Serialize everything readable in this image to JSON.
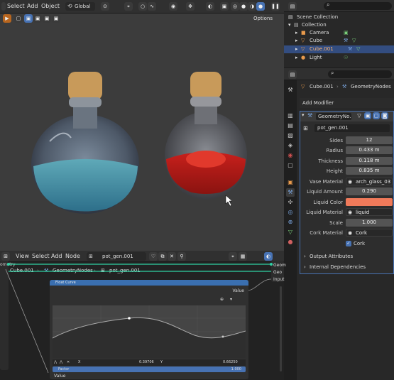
{
  "top_menu": {
    "select": "Select",
    "add": "Add",
    "object": "Object",
    "transform": "Global",
    "options": "Options"
  },
  "outliner": {
    "search_placeholder": "",
    "scene_collection": "Scene Collection",
    "collection": "Collection",
    "items": [
      {
        "label": "Camera"
      },
      {
        "label": "Cube"
      },
      {
        "label": "Cube.001"
      },
      {
        "label": "Light"
      }
    ]
  },
  "properties": {
    "breadcrumb_object": "Cube.001",
    "breadcrumb_modifier": "GeometryNodes",
    "add_modifier": "Add Modifier",
    "modifier_name": "GeometryNo...",
    "node_group": "pot_gen.001",
    "rows": [
      {
        "label": "Sides",
        "value": "12"
      },
      {
        "label": "Radius",
        "value": "0.433 m"
      },
      {
        "label": "Thickness",
        "value": "0.118 m"
      },
      {
        "label": "Height",
        "value": "0.835 m"
      },
      {
        "label": "Vase Material",
        "value": "arch_glass_03"
      },
      {
        "label": "Liquid Amount",
        "value": "0.290"
      },
      {
        "label": "Liquid Color",
        "value": ""
      },
      {
        "label": "Liquid Material",
        "value": "liquid"
      },
      {
        "label": "Scale",
        "value": "1.000"
      },
      {
        "label": "Cork Material",
        "value": "Cork"
      }
    ],
    "cork_checkbox": "Cork",
    "output_attributes": "Output Attributes",
    "internal_dependencies": "Internal Dependencies",
    "liquid_color_hex": "#f07a5a"
  },
  "node_editor": {
    "menu": {
      "view": "View",
      "select": "Select",
      "add": "Add",
      "node": "Node"
    },
    "node_group": "pot_gen.001",
    "breadcrumb": {
      "object": "Cube.001",
      "modifier": "GeometryNodes",
      "group": "pot_gen.001"
    },
    "left_label": "ometry",
    "right_labels": [
      "Geom",
      "Geo",
      "Input"
    ],
    "float_curve": {
      "title": "Float Curve",
      "value_out": "Value",
      "x_label": "X",
      "x_value": "0.39706",
      "y_label": "Y",
      "y_value": "0.66250",
      "factor_label": "Factor",
      "factor_value": "1.000",
      "value_in": "Value"
    }
  },
  "colors": {
    "accent": "#4772b3",
    "selection": "#334d80",
    "liquid_color": "#f07a5a"
  }
}
